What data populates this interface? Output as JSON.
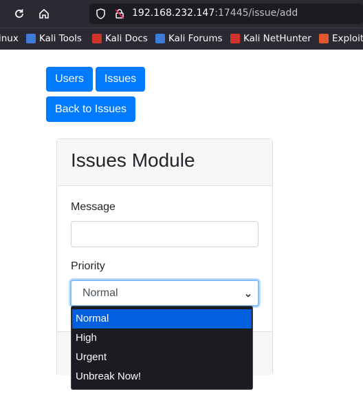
{
  "browser": {
    "url_host": "192.168.232.147",
    "url_path": ":17445/issue/add",
    "bookmarks": [
      {
        "label": "inux",
        "color": "#2b2a33"
      },
      {
        "label": "Kali Tools",
        "color": "#3d7bd9"
      },
      {
        "label": "Kali Docs",
        "color": "#d0342c"
      },
      {
        "label": "Kali Forums",
        "color": "#3d7bd9"
      },
      {
        "label": "Kali NetHunter",
        "color": "#d0342c"
      },
      {
        "label": "Exploit",
        "color": "#e2582b"
      }
    ]
  },
  "nav": {
    "users": "Users",
    "issues": "Issues",
    "back": "Back to Issues"
  },
  "card": {
    "title": "Issues Module",
    "message_label": "Message",
    "message_value": "",
    "priority_label": "Priority",
    "priority_value": "Normal"
  },
  "dropdown": {
    "options": [
      "Normal",
      "High",
      "Urgent",
      "Unbreak Now!"
    ],
    "selected_index": 0
  },
  "colors": {
    "primary": "#007bff",
    "dropdown_highlight": "#0060df"
  }
}
